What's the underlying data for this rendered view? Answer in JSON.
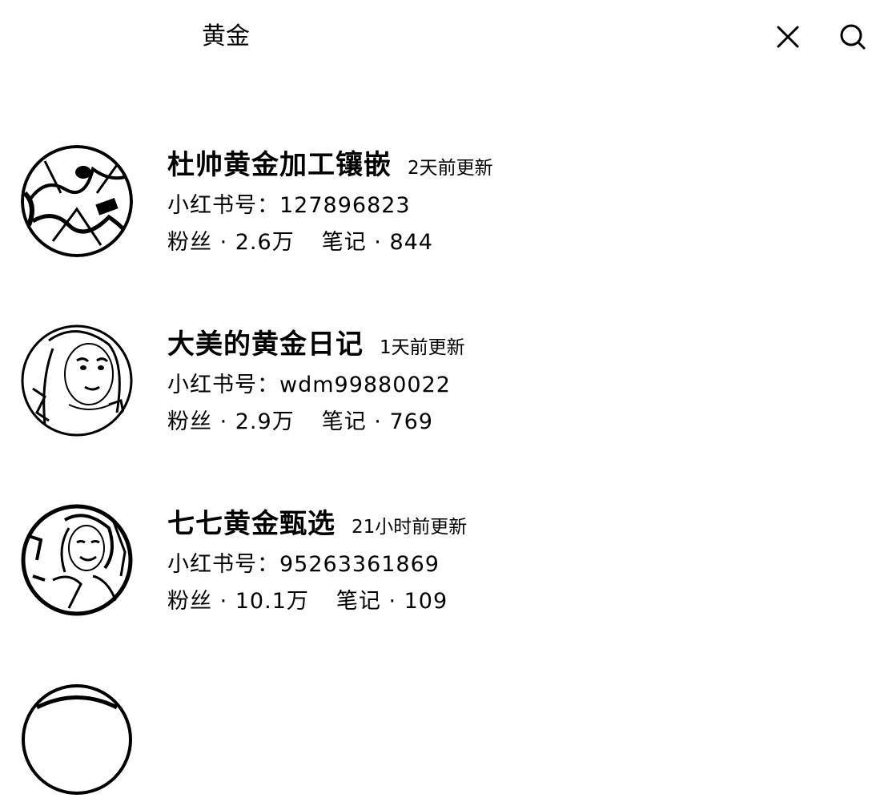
{
  "search": {
    "query": "黄金"
  },
  "results": [
    {
      "name": "杜帅黄金加工镶嵌",
      "updated": "2天前更新",
      "id_label": "小红书号：",
      "id_value": "127896823",
      "fans_label": "粉丝 · ",
      "fans_value": "2.6万",
      "notes_label": "笔记 · ",
      "notes_value": "844"
    },
    {
      "name": "大美的黄金日记",
      "updated": "1天前更新",
      "id_label": "小红书号：",
      "id_value": "wdm99880022",
      "fans_label": "粉丝 · ",
      "fans_value": "2.9万",
      "notes_label": "笔记 · ",
      "notes_value": "769"
    },
    {
      "name": "七七黄金甄选",
      "updated": "21小时前更新",
      "id_label": "小红书号：",
      "id_value": "95263361869",
      "fans_label": "粉丝 · ",
      "fans_value": "10.1万",
      "notes_label": "笔记 · ",
      "notes_value": "109"
    }
  ],
  "icons": {
    "clear": "close-icon",
    "search": "search-icon"
  },
  "colors": {
    "text": "#000000",
    "background": "#ffffff"
  }
}
